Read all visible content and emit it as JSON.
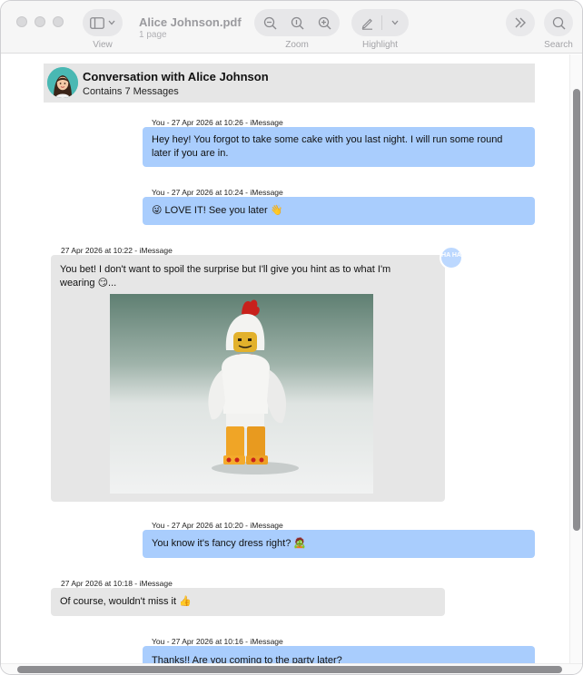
{
  "window": {
    "title": "Alice Johnson.pdf",
    "subtitle": "1 page"
  },
  "toolbar": {
    "view_label": "View",
    "zoom_label": "Zoom",
    "highlight_label": "Highlight",
    "search_label": "Search",
    "icons": [
      "sidebar-icon",
      "chevron-down-icon",
      "zoom-out-icon",
      "zoom-fit-icon",
      "zoom-in-icon",
      "highlighter-icon",
      "chevron-down-icon",
      "chevron-double-right-icon",
      "search-icon"
    ]
  },
  "conversation": {
    "title": "Conversation with Alice Johnson",
    "subtitle": "Contains 7 Messages"
  },
  "messages": [
    {
      "direction": "sent",
      "meta": "You - 27 Apr 2026 at 10:26 - iMessage",
      "lines": [
        "Hey hey! You forgot to take some cake with you last night. I will run some round",
        "later if you are in."
      ]
    },
    {
      "direction": "sent",
      "meta": "You - 27 Apr 2026 at 10:24 - iMessage",
      "lines": [
        "😜 LOVE IT! See you later 👋"
      ]
    },
    {
      "direction": "received",
      "meta": "27 Apr 2026 at 10:22 - iMessage",
      "lines": [
        "You bet! I don't want to spoil the surprise but I'll give you hint as to what I'm",
        "wearing 😏..."
      ],
      "attachment": "photo",
      "tapback": "HA HA"
    },
    {
      "direction": "sent",
      "meta": "You - 27 Apr 2026 at 10:20 - iMessage",
      "lines": [
        "You know it's fancy dress right? 🧟"
      ]
    },
    {
      "direction": "received",
      "meta": "27 Apr 2026 at 10:18 - iMessage",
      "lines": [
        "Of course, wouldn't miss it 👍"
      ]
    },
    {
      "direction": "sent",
      "meta": "You - 27 Apr 2026 at 10:16 - iMessage",
      "lines": [
        "Thanks!! Are you coming to the party later?"
      ]
    }
  ],
  "colors": {
    "sent_bubble": "#a9cdfd",
    "received_bubble": "#e6e6e6",
    "header_bg": "#e6e6e6",
    "toolbar_bg": "#f6f6f6"
  }
}
